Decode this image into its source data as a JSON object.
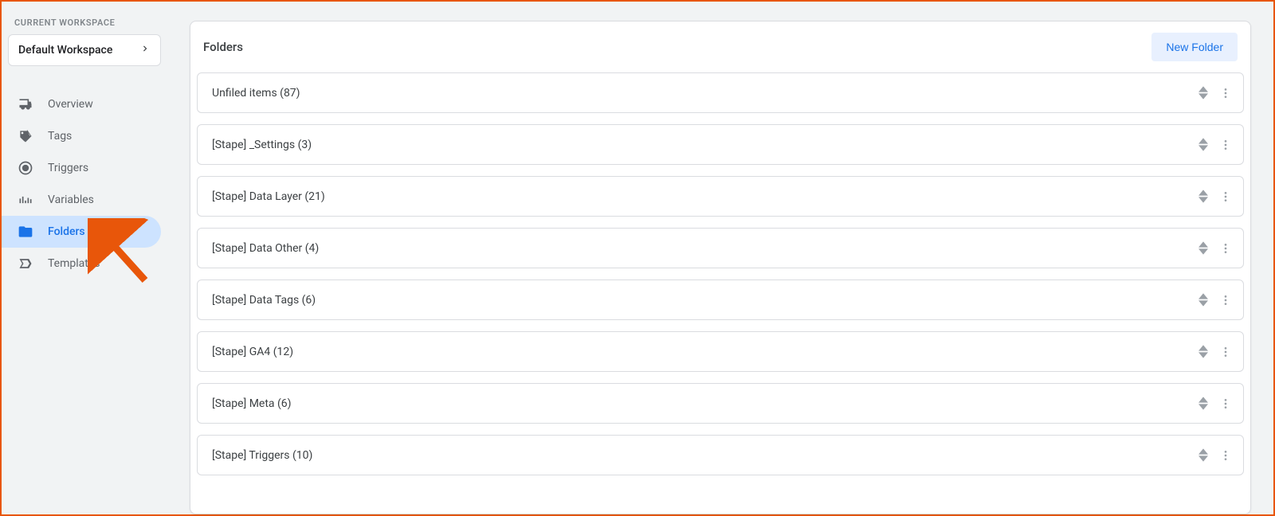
{
  "sidebar": {
    "workspace_label": "CURRENT WORKSPACE",
    "workspace_name": "Default Workspace",
    "items": [
      {
        "key": "overview",
        "label": "Overview"
      },
      {
        "key": "tags",
        "label": "Tags"
      },
      {
        "key": "triggers",
        "label": "Triggers"
      },
      {
        "key": "variables",
        "label": "Variables"
      },
      {
        "key": "folders",
        "label": "Folders"
      },
      {
        "key": "templates",
        "label": "Templates"
      }
    ],
    "active": "folders"
  },
  "main": {
    "panel_title": "Folders",
    "new_folder_label": "New Folder",
    "folders": [
      {
        "label": "Unfiled items (87)"
      },
      {
        "label": "[Stape] _Settings (3)"
      },
      {
        "label": "[Stape] Data Layer (21)"
      },
      {
        "label": "[Stape] Data Other (4)"
      },
      {
        "label": "[Stape] Data Tags (6)"
      },
      {
        "label": "[Stape] GA4 (12)"
      },
      {
        "label": "[Stape] Meta (6)"
      },
      {
        "label": "[Stape] Triggers (10)"
      }
    ]
  }
}
